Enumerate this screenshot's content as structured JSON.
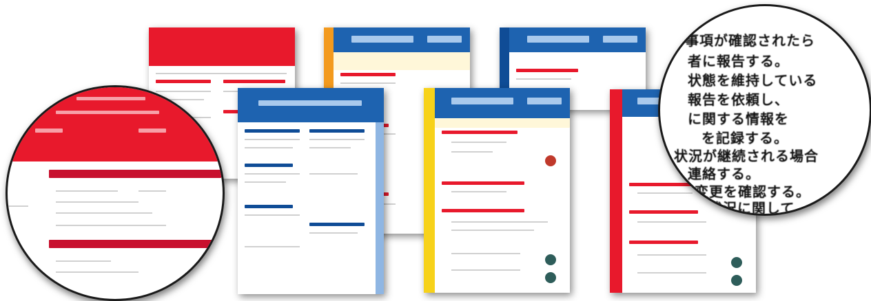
{
  "colors": {
    "red": "#e8192c",
    "blue": "#1e63b0",
    "dark_blue": "#0f4c96",
    "orange": "#f39a1e",
    "yellow": "#f7d21a",
    "light_blue": "#a9c9ec",
    "pale_yellow": "#fff7d9"
  },
  "zoom_text": {
    "lines": [
      "事項が確認されたら",
      "者に報告する。",
      "状態を維持している",
      "報告を依頼し、",
      "に関する情報を",
      "を記録する。",
      "状況が継続される場合",
      "連絡する。",
      "変更を確認する。",
      "状況に関して"
    ]
  }
}
